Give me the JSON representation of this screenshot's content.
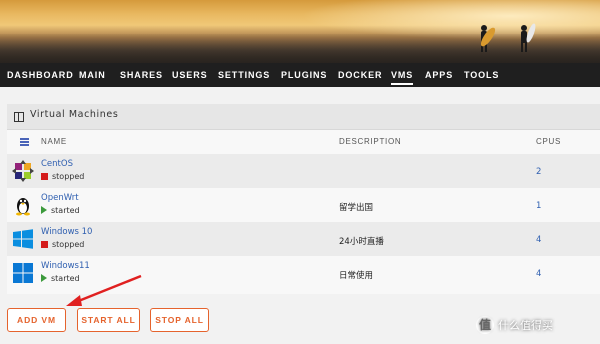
{
  "nav": {
    "items": [
      "DASHBOARD",
      "MAIN",
      "SHARES",
      "USERS",
      "SETTINGS",
      "PLUGINS",
      "DOCKER",
      "VMS",
      "APPS",
      "TOOLS"
    ],
    "active": "VMS"
  },
  "panel": {
    "title": "Virtual Machines"
  },
  "table": {
    "headers": {
      "name": "NAME",
      "description": "DESCRIPTION",
      "cpus": "CPUS"
    },
    "rows": [
      {
        "name": "CentOS",
        "state": "stopped",
        "description": "",
        "cpus": "2",
        "os_icon": "centos-icon"
      },
      {
        "name": "OpenWrt",
        "state": "started",
        "description": "留学出国",
        "cpus": "1",
        "os_icon": "linux-tux-icon"
      },
      {
        "name": "Windows 10",
        "state": "stopped",
        "description": "24小时直播",
        "cpus": "4",
        "os_icon": "windows10-icon"
      },
      {
        "name": "Windows11",
        "state": "started",
        "description": "日常使用",
        "cpus": "4",
        "os_icon": "windows11-icon"
      }
    ]
  },
  "buttons": {
    "add_vm": "ADD VM",
    "start_all": "START ALL",
    "stop_all": "STOP ALL"
  },
  "watermark": {
    "badge": "值",
    "text": "什么值得买"
  },
  "colors": {
    "accent": "#e5632d",
    "link": "#2f5fb0",
    "stopped": "#d41b1b",
    "started": "#3c9a3c",
    "arrow": "#e02020"
  }
}
